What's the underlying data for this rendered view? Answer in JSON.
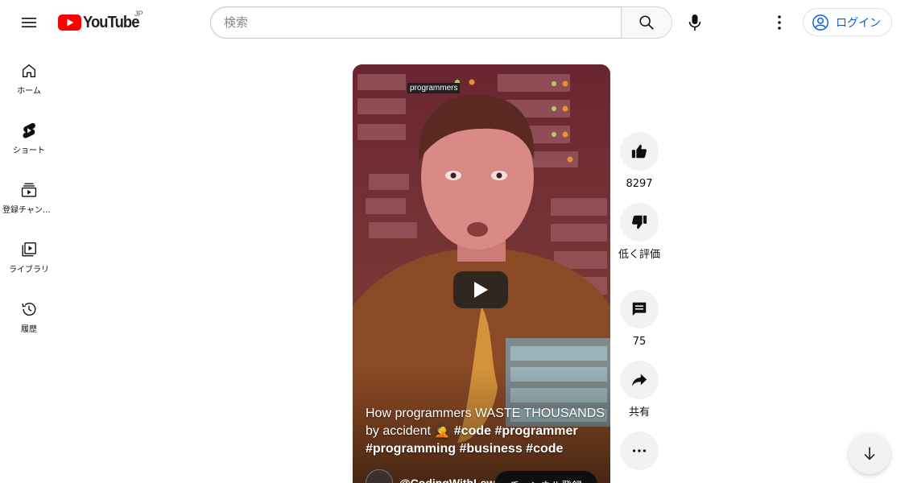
{
  "header": {
    "logo_text": "YouTube",
    "country_code": "JP",
    "search_placeholder": "検索",
    "login_label": "ログイン"
  },
  "sidebar": {
    "items": [
      {
        "label": "ホーム",
        "icon": "home-icon"
      },
      {
        "label": "ショート",
        "icon": "shorts-icon"
      },
      {
        "label": "登録チャンネル",
        "icon": "subscriptions-icon"
      },
      {
        "label": "ライブラリ",
        "icon": "library-icon"
      },
      {
        "label": "履歴",
        "icon": "history-icon"
      }
    ]
  },
  "short": {
    "overlay_text": "programmers",
    "caption_text": "How programmers WASTE THOUSANDS by accident 🤦",
    "caption_tags": "#code #programmer #programming #business #code",
    "channel_name": "@CodingWithLewis",
    "subscribe_label": "チャンネル登録"
  },
  "actions": {
    "like_count": "8297",
    "dislike_label": "低く評価",
    "comment_count": "75",
    "share_label": "共有"
  },
  "colors": {
    "brand_red": "#ff0000",
    "link_blue": "#065fd4",
    "video_tint": "#5a1e22"
  }
}
